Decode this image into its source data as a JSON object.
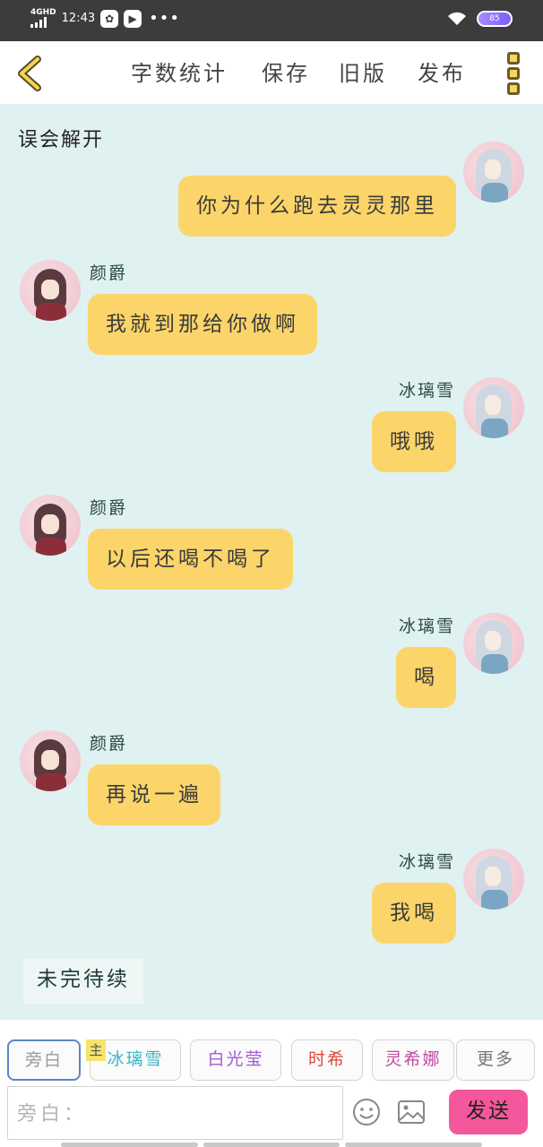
{
  "status_bar": {
    "network": "4GHD",
    "time": "12:43",
    "more": "•••",
    "battery": "85"
  },
  "toolbar": {
    "word_count": "字数统计",
    "save": "保存",
    "old_version": "旧版",
    "publish": "发布"
  },
  "chapter_title": "误会解开",
  "messages": [
    {
      "side": "right",
      "name": "",
      "text": "你为什么跑去灵灵那里"
    },
    {
      "side": "left",
      "name": "颜爵",
      "text": "我就到那给你做啊"
    },
    {
      "side": "right",
      "name": "冰璃雪",
      "text": "哦哦"
    },
    {
      "side": "left",
      "name": "颜爵",
      "text": "以后还喝不喝了"
    },
    {
      "side": "right",
      "name": "冰璃雪",
      "text": "喝"
    },
    {
      "side": "left",
      "name": "颜爵",
      "text": "再说一遍"
    },
    {
      "side": "right",
      "name": "冰璃雪",
      "text": "我喝"
    }
  ],
  "to_be_continued": "未完待续",
  "roles": {
    "narration": {
      "label": "旁白",
      "color": "#9a9a9a"
    },
    "host_tag": "主",
    "bingli": {
      "label": "冰璃雪",
      "color": "#3bb3c3"
    },
    "baiguang": {
      "label": "白光莹",
      "color": "#a15bd1"
    },
    "shixi": {
      "label": "时希",
      "color": "#e0463a"
    },
    "lingxina": {
      "label": "灵希娜",
      "color": "#c34aa4"
    },
    "more": {
      "label": "更多",
      "color": "#777777"
    }
  },
  "input": {
    "placeholder": "旁白："
  },
  "send_label": "发送",
  "colors": {
    "bubble": "#fcd56a",
    "chat_bg": "#dff1f0",
    "send": "#f4579b"
  }
}
